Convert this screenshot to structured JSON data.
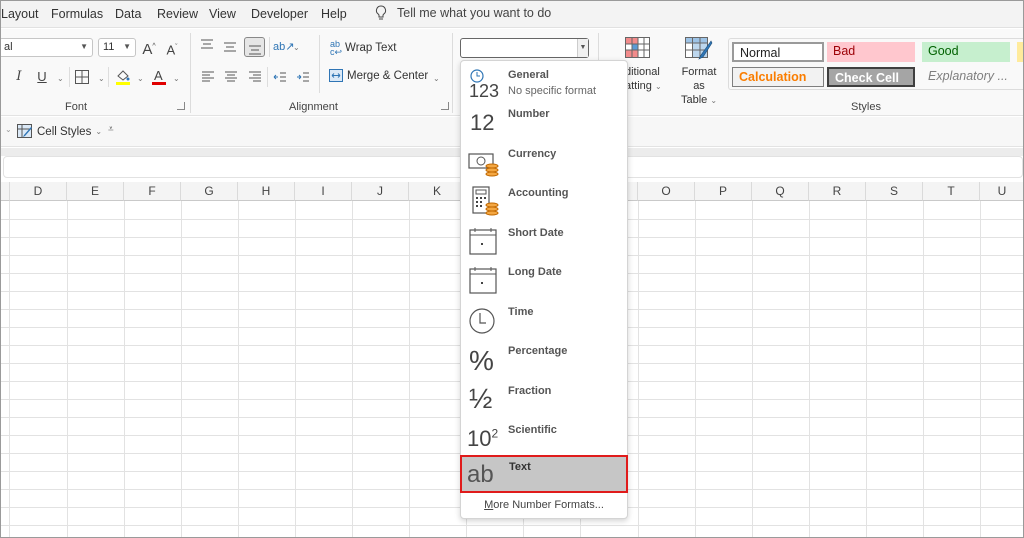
{
  "menu": {
    "items": [
      "Layout",
      "Formulas",
      "Data",
      "Review",
      "View",
      "Developer",
      "Help"
    ],
    "tell_me": "Tell me what you want to do"
  },
  "ribbon": {
    "font": {
      "font_name": "al",
      "font_size": "11",
      "group_label": "Font"
    },
    "alignment": {
      "wrap_text": "Wrap Text",
      "merge_center": "Merge & Center",
      "group_label": "Alignment"
    },
    "number": {
      "format_value": ""
    },
    "styles": {
      "conditional_formatting_line1": "ditional",
      "conditional_formatting_line2": "atting",
      "format_as_table_line1": "Format as",
      "format_as_table_line2": "Table",
      "group_label": "Styles",
      "cells": [
        {
          "label": "Normal",
          "bg": "#ffffff",
          "color": "#222222"
        },
        {
          "label": "Bad",
          "bg": "#ffc7ce",
          "color": "#9c0006"
        },
        {
          "label": "Good",
          "bg": "#c6efce",
          "color": "#006100"
        },
        {
          "label": "Calculation",
          "bg": "#f2f2f2",
          "color": "#fa7d00"
        },
        {
          "label": "Check Cell",
          "bg": "#a5a5a5",
          "color": "#ffffff"
        },
        {
          "label": "Explanatory ...",
          "bg": "#f9f9f9",
          "color": "#7f7f7f"
        }
      ]
    }
  },
  "quickbar": {
    "cell_styles": "Cell Styles"
  },
  "grid": {
    "columns_left": [
      "D",
      "E",
      "F",
      "G",
      "H",
      "I",
      "J",
      "K"
    ],
    "columns_right": [
      "O",
      "P",
      "Q",
      "R",
      "S",
      "T",
      "U"
    ]
  },
  "number_format_dropdown": {
    "items": [
      {
        "label": "General",
        "sublabel": "No specific format",
        "icon": "general-123-icon"
      },
      {
        "label": "Number",
        "icon": "number-12-icon"
      },
      {
        "label": "Currency",
        "icon": "currency-icon"
      },
      {
        "label": "Accounting",
        "icon": "accounting-icon"
      },
      {
        "label": "Short Date",
        "icon": "calendar-icon"
      },
      {
        "label": "Long Date",
        "icon": "calendar-icon"
      },
      {
        "label": "Time",
        "icon": "clock-icon"
      },
      {
        "label": "Percentage",
        "icon": "percent-icon"
      },
      {
        "label": "Fraction",
        "icon": "fraction-icon"
      },
      {
        "label": "Scientific",
        "icon": "scientific-icon"
      },
      {
        "label": "Text",
        "icon": "text-ab-icon",
        "selected": true
      }
    ],
    "more": "More Number Formats...",
    "icon_text": {
      "general": "123",
      "number": "12",
      "fraction": "½",
      "scientific_base": "10",
      "scientific_exp": "2",
      "percent": "%",
      "text": "ab"
    },
    "highlight_color": "#e01b1b"
  }
}
